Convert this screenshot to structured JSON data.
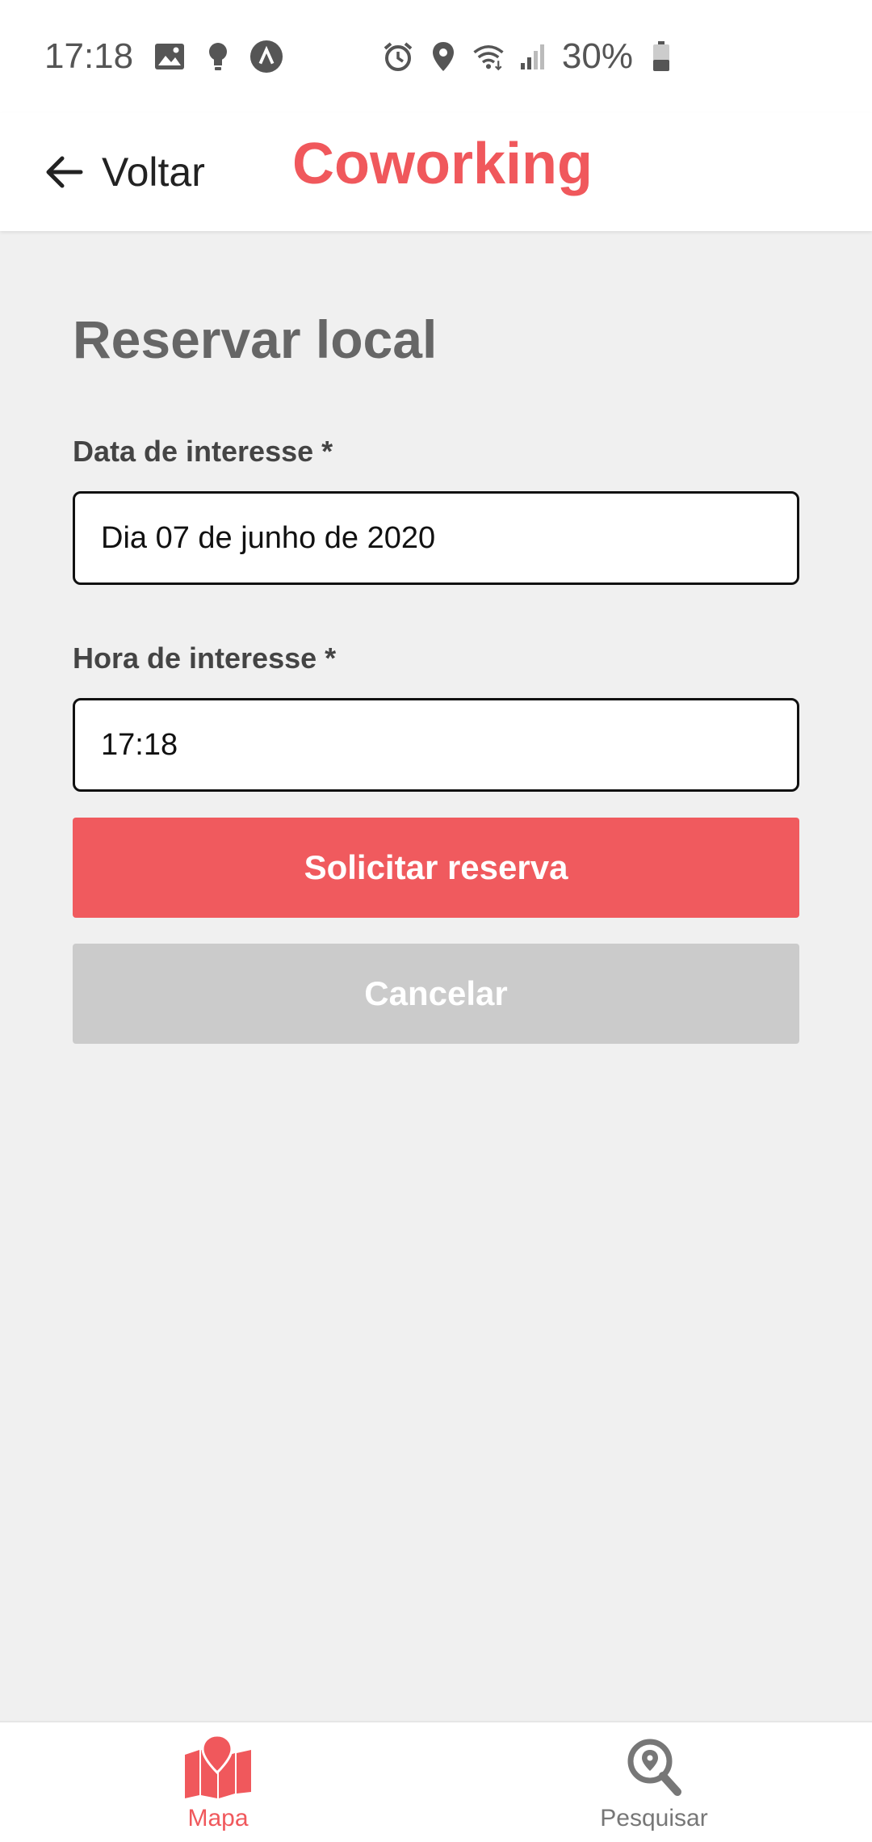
{
  "status_bar": {
    "time": "17:18",
    "battery_percent": "30%",
    "icons_left": [
      "image-icon",
      "bulb-icon",
      "app-icon"
    ],
    "icons_right": [
      "alarm-icon",
      "location-icon",
      "wifi-icon",
      "signal-icon",
      "battery-icon"
    ]
  },
  "header": {
    "back_label": "Voltar",
    "title": "Coworking"
  },
  "form": {
    "title": "Reservar local",
    "date_label": "Data de interesse *",
    "date_value": "Dia 07 de junho de 2020",
    "time_label": "Hora de interesse *",
    "time_value": "17:18",
    "submit_label": "Solicitar reserva",
    "cancel_label": "Cancelar"
  },
  "bottom_nav": {
    "items": [
      {
        "label": "Mapa",
        "icon": "map-pin-icon",
        "active": true
      },
      {
        "label": "Pesquisar",
        "icon": "search-location-icon",
        "active": false
      }
    ]
  },
  "colors": {
    "accent": "#f0585c",
    "button_primary": "#f05a5e",
    "button_disabled": "#cbcbcb",
    "background": "#f0f0f0"
  }
}
